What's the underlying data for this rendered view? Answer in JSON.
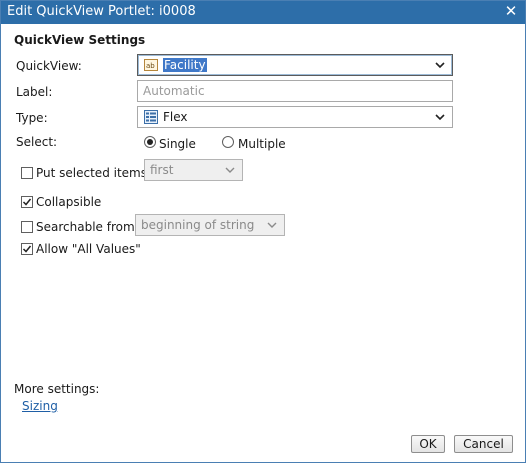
{
  "dialog": {
    "title": "Edit QuickView Portlet: i0008",
    "close_glyph": "✕"
  },
  "settings": {
    "section_title": "QuickView Settings",
    "quickview": {
      "label": "QuickView:",
      "value": "Facility",
      "icon": "text-field-icon"
    },
    "label_field": {
      "label": "Label:",
      "placeholder": "Automatic"
    },
    "type": {
      "label": "Type:",
      "value": "Flex",
      "icon": "flex-list-icon"
    },
    "select": {
      "label": "Select:",
      "options": [
        {
          "label": "Single",
          "checked": true
        },
        {
          "label": "Multiple",
          "checked": false
        }
      ]
    },
    "put_selected": {
      "label": "Put selected items",
      "checked": false,
      "dropdown_value": "first"
    },
    "collapsible": {
      "label": "Collapsible",
      "checked": true
    },
    "searchable": {
      "label": "Searchable from",
      "checked": false,
      "dropdown_value": "beginning of string"
    },
    "allow_all": {
      "label": "Allow \"All Values\"",
      "checked": true
    }
  },
  "more": {
    "label": "More settings:",
    "sizing_link": "Sizing"
  },
  "buttons": {
    "ok": "OK",
    "cancel": "Cancel"
  },
  "colors": {
    "titlebar": "#2d6ea9",
    "selection": "#3f78c8",
    "link": "#1f5fa6"
  }
}
